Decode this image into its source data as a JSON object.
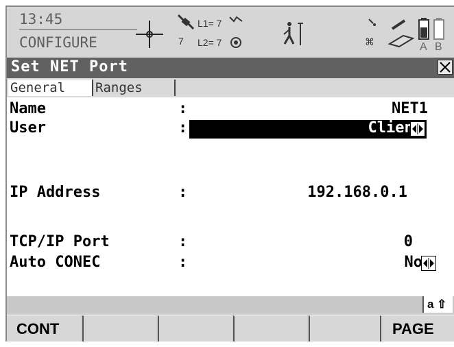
{
  "status": {
    "time": "13:45",
    "mode": "CONFIGURE",
    "sat_label_l1": "L1= 7",
    "sat_label_l2": "L2= 7",
    "sat_count": "7",
    "battery_a": "A",
    "battery_b": "B"
  },
  "dialog": {
    "title": "Set NET Port",
    "tabs": [
      {
        "label": "General",
        "active": true
      },
      {
        "label": "Ranges",
        "active": false
      }
    ]
  },
  "fields": [
    {
      "label": "Name",
      "value": "NET1",
      "selectable": false,
      "highlighted": false
    },
    {
      "label": "User",
      "value": "Client",
      "selectable": true,
      "highlighted": true
    },
    {
      "label": "IP Address",
      "value": "192.168.0.1",
      "selectable": false,
      "highlighted": false
    },
    {
      "label": "TCP/IP Port",
      "value": "0",
      "selectable": false,
      "highlighted": false
    },
    {
      "label": "Auto CONEC",
      "value": "No",
      "selectable": true,
      "highlighted": false
    }
  ],
  "colon": ":",
  "input_mode": "a ⇧",
  "softkeys": [
    "CONT",
    "",
    "",
    "",
    "",
    "PAGE"
  ]
}
